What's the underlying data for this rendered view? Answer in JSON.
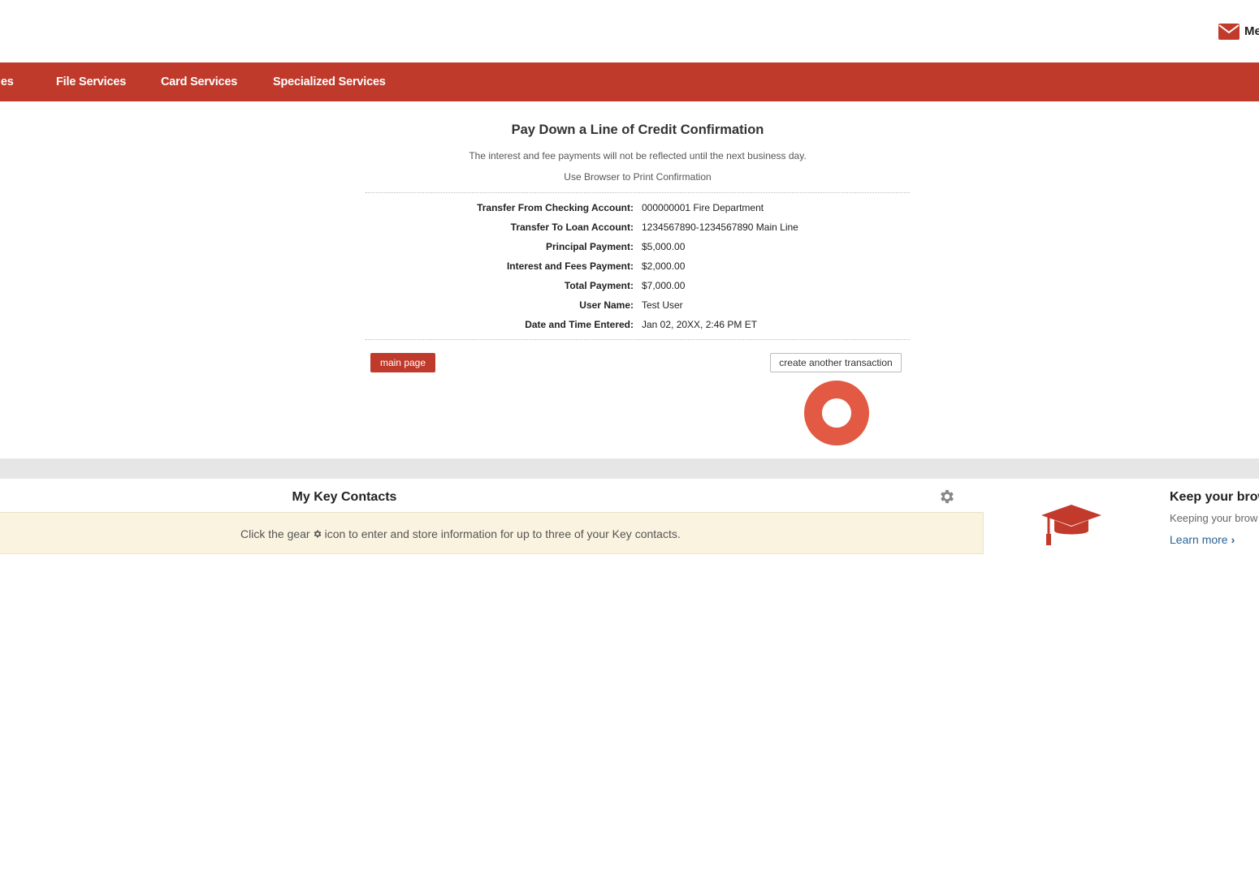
{
  "header": {
    "messages_label": "Me",
    "mail_icon": "envelope-icon"
  },
  "nav": {
    "items": [
      {
        "label": "les"
      },
      {
        "label": "File Services"
      },
      {
        "label": "Card Services"
      },
      {
        "label": "Specialized Services"
      }
    ],
    "background": "#bf3a2b"
  },
  "confirmation": {
    "title": "Pay Down a Line of Credit Confirmation",
    "note": "The interest and fee payments will not be reflected until the next business day.",
    "print_hint": "Use Browser to Print Confirmation",
    "rows": [
      {
        "label": "Transfer From Checking Account:",
        "value": "000000001 Fire Department"
      },
      {
        "label": "Transfer To Loan Account:",
        "value": "1234567890-1234567890 Main Line"
      },
      {
        "label": "Principal Payment:",
        "value": "$5,000.00"
      },
      {
        "label": "Interest and Fees Payment:",
        "value": "$2,000.00"
      },
      {
        "label": "Total Payment:",
        "value": "$7,000.00"
      },
      {
        "label": "User Name:",
        "value": "Test User"
      },
      {
        "label": "Date and Time Entered:",
        "value": "Jan 02, 20XX, 2:46 PM ET"
      }
    ],
    "main_page_button": "main page",
    "create_button": "create another transaction"
  },
  "contacts": {
    "title": "My Key Contacts",
    "message_before": "Click the gear",
    "message_after": "icon to enter and store information for up to three of your Key contacts."
  },
  "promo": {
    "title": "Keep your brow",
    "subtitle": "Keeping your brow",
    "link": "Learn more",
    "icon": "graduation-cap-icon"
  },
  "colors": {
    "brand_red": "#bf3a2b",
    "highlight_ring": "#e25a43",
    "notice_bg": "#faf3e0",
    "link": "#2a6496"
  }
}
